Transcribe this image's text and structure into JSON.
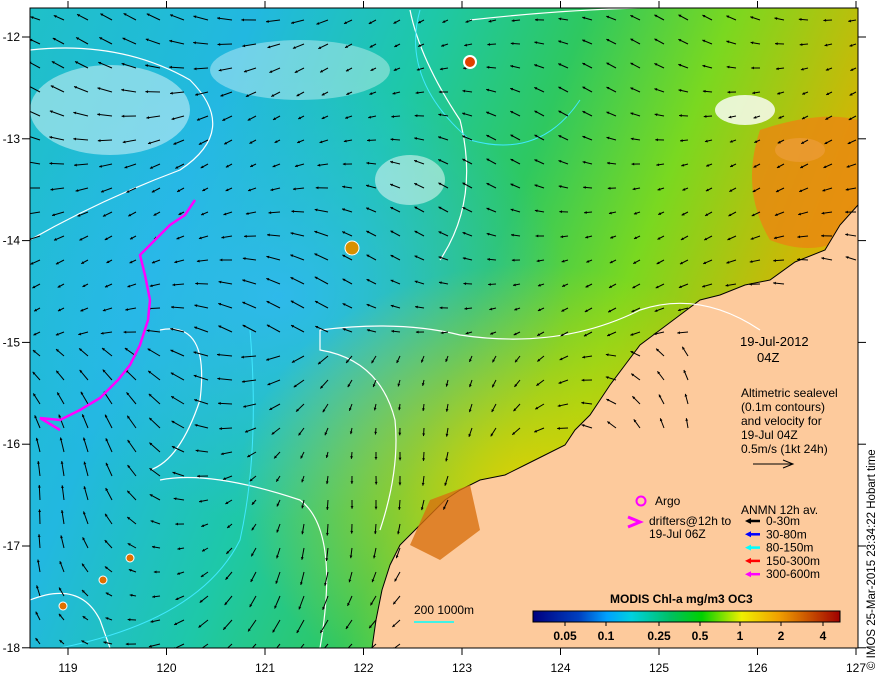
{
  "map": {
    "date": "19-Jul-2012",
    "time": "04Z",
    "x_ticks": [
      "119",
      "120",
      "121",
      "122",
      "123",
      "124",
      "125",
      "126",
      "127"
    ],
    "y_ticks": [
      "-12",
      "-13",
      "-14",
      "-15",
      "-16",
      "-17",
      "-18"
    ],
    "altimetry_note": [
      "Altimetric sealevel",
      "(0.1m contours)",
      "and velocity for",
      "19-Jul 04Z",
      "0.5m/s (1kt 24h)"
    ],
    "argo_label": "Argo",
    "drifters_label": [
      "drifters@12h to",
      "19-Jul 06Z"
    ],
    "anmn": {
      "title": "ANMN 12h av.",
      "items": [
        {
          "label": "0-30m",
          "color": "#000000"
        },
        {
          "label": "30-80m",
          "color": "#0000ff"
        },
        {
          "label": "80-150m",
          "color": "#00ffff"
        },
        {
          "label": "150-300m",
          "color": "#ff0000"
        },
        {
          "label": "300-600m",
          "color": "#ff00ff"
        }
      ]
    },
    "depth_legend": "200  1000m",
    "colorbar": {
      "title": "MODIS Chl-a mg/m3 OC3",
      "ticks": [
        "0.05",
        "0.1",
        "0.25",
        "0.5",
        "1",
        "2",
        "4"
      ]
    },
    "credit": "© IMOS 25-Mar-2015 23:34:22 Hobart time",
    "colors": {
      "land": "#fdca9c",
      "drifter": "#ff00ff",
      "contour": "#ffffff",
      "isobath": "#00ffff"
    }
  }
}
